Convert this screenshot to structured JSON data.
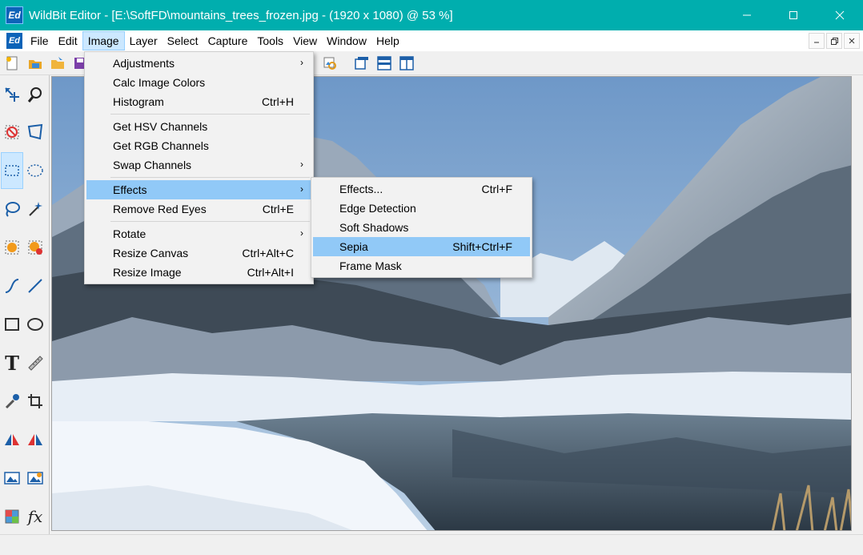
{
  "window": {
    "title": "WildBit Editor - [E:\\SoftFD\\mountains_trees_frozen.jpg - (1920 x 1080) @ 53  %]",
    "app_icon_text": "Ed"
  },
  "menubar": {
    "items": [
      "File",
      "Edit",
      "Image",
      "Layer",
      "Select",
      "Capture",
      "Tools",
      "View",
      "Window",
      "Help"
    ],
    "active": "Image"
  },
  "image_menu": {
    "groups": [
      [
        {
          "label": "Adjustments",
          "shortcut": "",
          "submenu": true
        },
        {
          "label": "Calc Image Colors",
          "shortcut": "",
          "submenu": false
        },
        {
          "label": "Histogram",
          "shortcut": "Ctrl+H",
          "submenu": false
        }
      ],
      [
        {
          "label": "Get HSV Channels",
          "shortcut": "",
          "submenu": false
        },
        {
          "label": "Get RGB Channels",
          "shortcut": "",
          "submenu": false
        },
        {
          "label": "Swap Channels",
          "shortcut": "",
          "submenu": true
        }
      ],
      [
        {
          "label": "Effects",
          "shortcut": "",
          "submenu": true,
          "highlighted": true
        },
        {
          "label": "Remove Red Eyes",
          "shortcut": "Ctrl+E",
          "submenu": false
        }
      ],
      [
        {
          "label": "Rotate",
          "shortcut": "",
          "submenu": true
        },
        {
          "label": "Resize Canvas",
          "shortcut": "Ctrl+Alt+C",
          "submenu": false
        },
        {
          "label": "Resize Image",
          "shortcut": "Ctrl+Alt+I",
          "submenu": false
        }
      ]
    ]
  },
  "effects_menu": {
    "items": [
      {
        "label": "Effects...",
        "shortcut": "Ctrl+F"
      },
      {
        "label": "Edge Detection",
        "shortcut": ""
      },
      {
        "label": "Soft Shadows",
        "shortcut": ""
      },
      {
        "label": "Sepia",
        "shortcut": "Shift+Ctrl+F",
        "highlighted": true
      },
      {
        "label": "Frame Mask",
        "shortcut": ""
      }
    ]
  },
  "tools": {
    "icons": [
      "move-icon",
      "zoom-icon",
      "erase-selection-icon",
      "transform-icon",
      "rect-select-icon",
      "ellipse-select-icon",
      "lasso-icon",
      "magic-wand-icon",
      "fill-shape-icon",
      "clear-shape-icon",
      "curve-icon",
      "line-icon",
      "rectangle-icon",
      "ellipse-icon",
      "text-icon",
      "ruler-icon",
      "eyedropper-icon",
      "crop-icon",
      "flip-horizontal-icon",
      "flip-vertical-icon",
      "picture-icon",
      "picture-adjust-icon",
      "color-palette-icon",
      "fx-icon"
    ],
    "text_glyph": "T",
    "fx_glyph": "fx"
  },
  "colors": {
    "titlebar": "#00aeae",
    "menu_highlight": "#91c9f7",
    "tool_selected": "#cce8ff"
  }
}
